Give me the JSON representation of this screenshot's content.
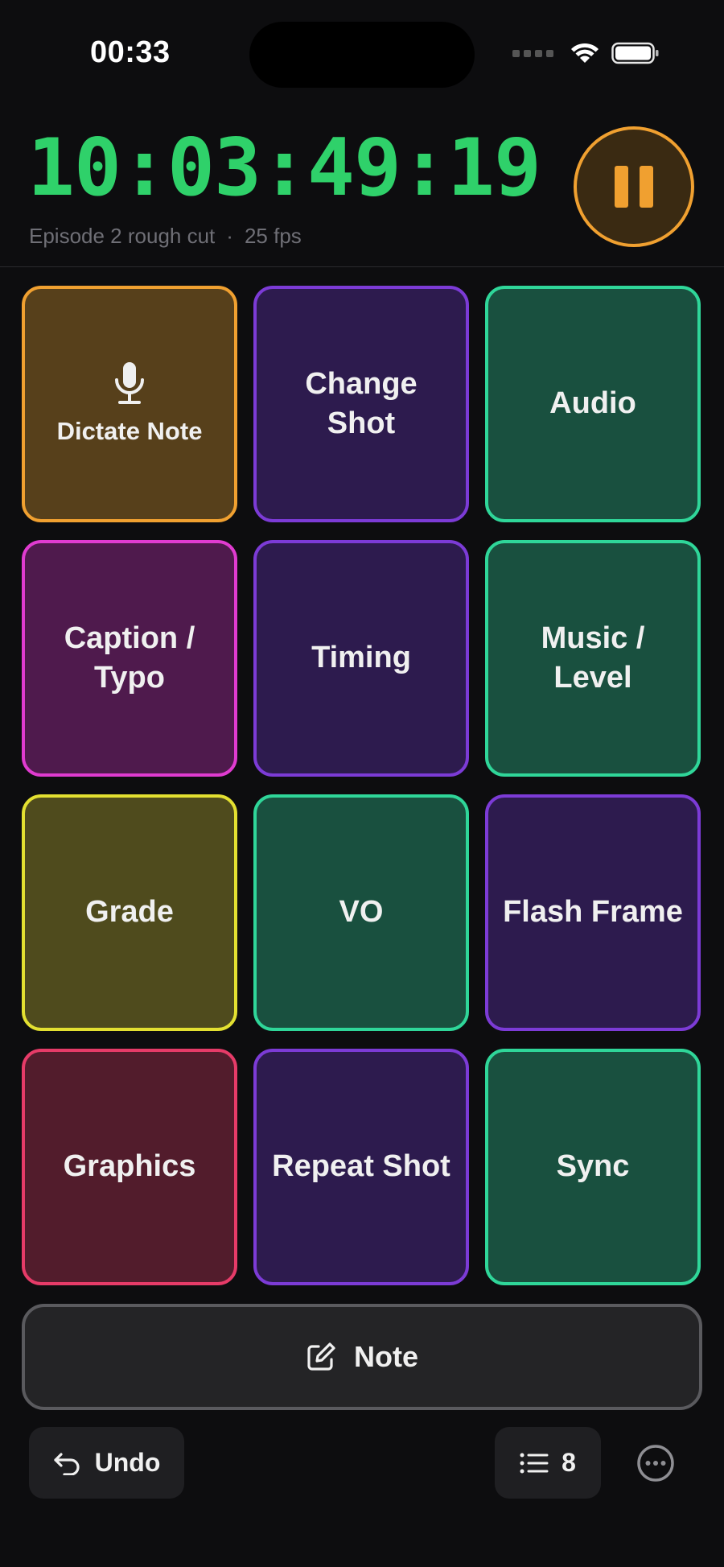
{
  "status_bar": {
    "time": "00:33",
    "icons": [
      "signal-icon",
      "wifi-icon",
      "battery-icon"
    ]
  },
  "header": {
    "timecode": "10:03:49:19",
    "project": "Episode 2 rough cut",
    "separator": "·",
    "fps": "25 fps",
    "timecode_color": "#2fd16a",
    "pause_button_icon": "pause-icon",
    "pause_color": "#f0a030"
  },
  "tiles": [
    {
      "label": "Dictate Note",
      "icon": "microphone-icon",
      "color": "#f0a030"
    },
    {
      "label": "Change\nShot",
      "color": "#7c3bd6"
    },
    {
      "label": "Audio",
      "color": "#2fd699"
    },
    {
      "label": "Caption /\nTypo",
      "color": "#e03bd0"
    },
    {
      "label": "Timing",
      "color": "#7c3bd6"
    },
    {
      "label": "Music /\nLevel",
      "color": "#2fd699"
    },
    {
      "label": "Grade",
      "color": "#e3e031"
    },
    {
      "label": "VO",
      "color": "#2fd699"
    },
    {
      "label": "Flash Frame",
      "color": "#7c3bd6"
    },
    {
      "label": "Graphics",
      "color": "#e63b68"
    },
    {
      "label": "Repeat Shot",
      "color": "#7c3bd6"
    },
    {
      "label": "Sync",
      "color": "#2fd699"
    }
  ],
  "note_bar": {
    "label": "Note",
    "icon": "compose-icon"
  },
  "toolbar": {
    "undo_label": "Undo",
    "undo_icon": "undo-arrow-icon",
    "list_count": "8",
    "list_icon": "list-icon",
    "more_icon": "more-circle-icon"
  }
}
